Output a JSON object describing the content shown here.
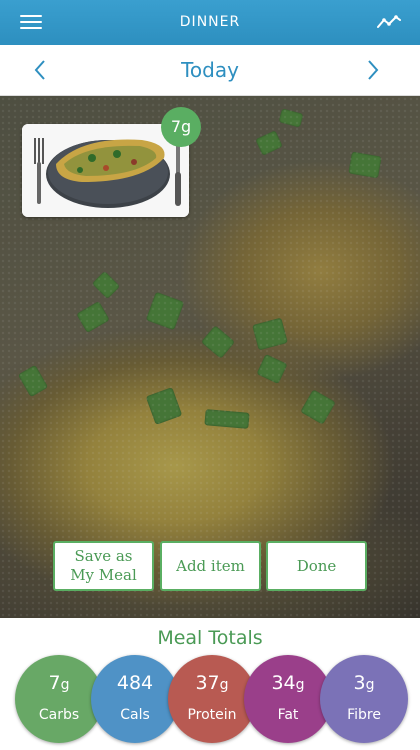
{
  "header": {
    "title": "DINNER",
    "menu_icon": "menu-icon",
    "trend_icon": "trend-chart-icon"
  },
  "datebar": {
    "label": "Today",
    "prev_icon": "chevron-left-icon",
    "next_icon": "chevron-right-icon"
  },
  "meal_item": {
    "badge": "7g",
    "image": "frittata-plate-thumbnail"
  },
  "actions": {
    "save_label": "Save as\nMy Meal",
    "add_label": "Add item",
    "done_label": "Done"
  },
  "totals": {
    "title": "Meal Totals",
    "items": [
      {
        "value": "7",
        "unit": "g",
        "label": "Carbs",
        "color": "#68a866"
      },
      {
        "value": "484",
        "unit": "",
        "label": "Cals",
        "color": "#4f92c6"
      },
      {
        "value": "37",
        "unit": "g",
        "label": "Protein",
        "color": "#b85a52"
      },
      {
        "value": "34",
        "unit": "g",
        "label": "Fat",
        "color": "#9a3f8a"
      },
      {
        "value": "3",
        "unit": "g",
        "label": "Fibre",
        "color": "#7b72b7"
      }
    ]
  },
  "colors": {
    "brand_blue": "#2e8fc0",
    "accent_green": "#5aae62"
  }
}
